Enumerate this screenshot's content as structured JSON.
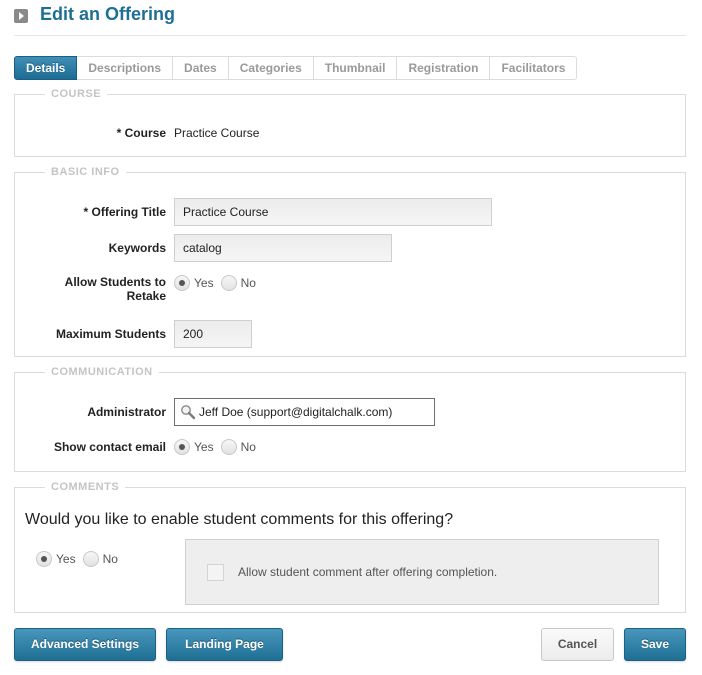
{
  "header": {
    "title": "Edit an Offering",
    "icon": "play-square-icon"
  },
  "tabs": [
    {
      "label": "Details",
      "active": true
    },
    {
      "label": "Descriptions",
      "active": false
    },
    {
      "label": "Dates",
      "active": false
    },
    {
      "label": "Categories",
      "active": false
    },
    {
      "label": "Thumbnail",
      "active": false
    },
    {
      "label": "Registration",
      "active": false
    },
    {
      "label": "Facilitators",
      "active": false
    }
  ],
  "course": {
    "legend": "COURSE",
    "label": "* Course",
    "value": "Practice Course"
  },
  "basic_info": {
    "legend": "BASIC INFO",
    "offering_title_label": "* Offering Title",
    "offering_title_value": "Practice Course",
    "keywords_label": "Keywords",
    "keywords_value": "catalog",
    "retake_label_line1": "Allow Students to",
    "retake_label_line2": "Retake",
    "retake_yes": "Yes",
    "retake_no": "No",
    "retake_selected": "Yes",
    "max_students_label": "Maximum Students",
    "max_students_value": "200"
  },
  "communication": {
    "legend": "COMMUNICATION",
    "administrator_label": "Administrator",
    "administrator_value": "Jeff Doe (support@digitalchalk.com)",
    "administrator_icon": "search-icon",
    "show_email_label": "Show contact email",
    "show_email_yes": "Yes",
    "show_email_no": "No",
    "show_email_selected": "Yes"
  },
  "comments": {
    "legend": "COMMENTS",
    "question": "Would you like to enable student comments for this offering?",
    "yes": "Yes",
    "no": "No",
    "selected": "Yes",
    "after_completion_label": "Allow student comment after offering completion.",
    "after_completion_checked": false
  },
  "buttons": {
    "advanced_settings": "Advanced Settings",
    "landing_page": "Landing Page",
    "cancel": "Cancel",
    "save": "Save"
  },
  "colors": {
    "accent": "#1e6f94",
    "button_blue": "#2b7ca3"
  }
}
